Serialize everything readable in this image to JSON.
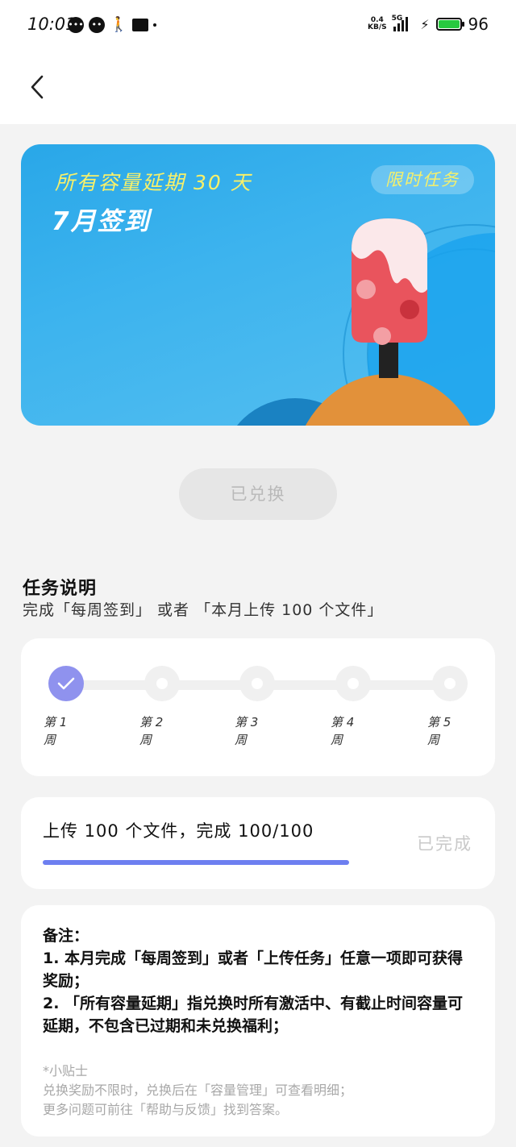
{
  "status_bar": {
    "time": "10:01",
    "net_speed_value": "0.4",
    "net_speed_unit": "KB/S",
    "network": "5G",
    "battery": "96",
    "left_icons": [
      "message-icon",
      "chat-icon",
      "walk-icon",
      "gallery-icon"
    ]
  },
  "nav": {
    "back_icon": "chevron-left-icon"
  },
  "banner": {
    "subtitle": "所有容量延期 30 天",
    "title": "7月签到",
    "tag": "限时任务"
  },
  "redeem_button": "已兑换",
  "task": {
    "title": "任务说明",
    "description": "完成「每周签到」 或者 「本月上传 100 个文件」"
  },
  "weeks": [
    {
      "label": "第 1 周",
      "done": true
    },
    {
      "label": "第 2 周",
      "done": false
    },
    {
      "label": "第 3 周",
      "done": false
    },
    {
      "label": "第 4 周",
      "done": false
    },
    {
      "label": "第 5 周",
      "done": false
    }
  ],
  "upload": {
    "text": "上传 100 个文件，完成 100/100",
    "status": "已完成",
    "progress": 1.0
  },
  "notes": {
    "heading": "备注：",
    "line1": "1. 本月完成「每周签到」或者「上传任务」任意一项即可获得奖励；",
    "line2": "2. 「所有容量延期」指兑换时所有激活中、有截止时间容量可延期，不包含已过期和未兑换福利；"
  },
  "tips": {
    "heading": "*小贴士",
    "line1": "兑换奖励不限时，兑换后在「容量管理」可查看明细；",
    "line2": "更多问题可前往「帮助与反馈」找到答案。"
  },
  "colors": {
    "accent": "#6d7ff0",
    "check": "#8f92ee",
    "banner_text": "#f7f06a",
    "banner_bg": "#3cb3ee"
  }
}
